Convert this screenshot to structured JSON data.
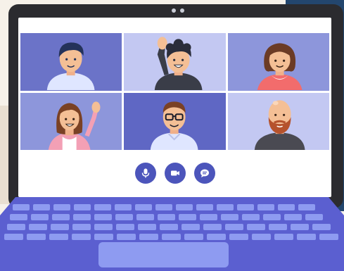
{
  "scene": {
    "icons": [
      "microphone-icon",
      "video-camera-icon",
      "chat-bubble-icon"
    ],
    "participants": [
      {
        "id": "p1",
        "bg": "#6b73c8"
      },
      {
        "id": "p2",
        "bg": "#c3c8f2"
      },
      {
        "id": "p3",
        "bg": "#8d96db"
      },
      {
        "id": "p4",
        "bg": "#8d96db"
      },
      {
        "id": "p5",
        "bg": "#5f67c4"
      },
      {
        "id": "p6",
        "bg": "#c3c8f2"
      }
    ]
  },
  "colors": {
    "accent": "#4c55bb",
    "deck": "#5b5fd0",
    "key": "#8e9bf1",
    "lid": "#2b2b2f"
  }
}
